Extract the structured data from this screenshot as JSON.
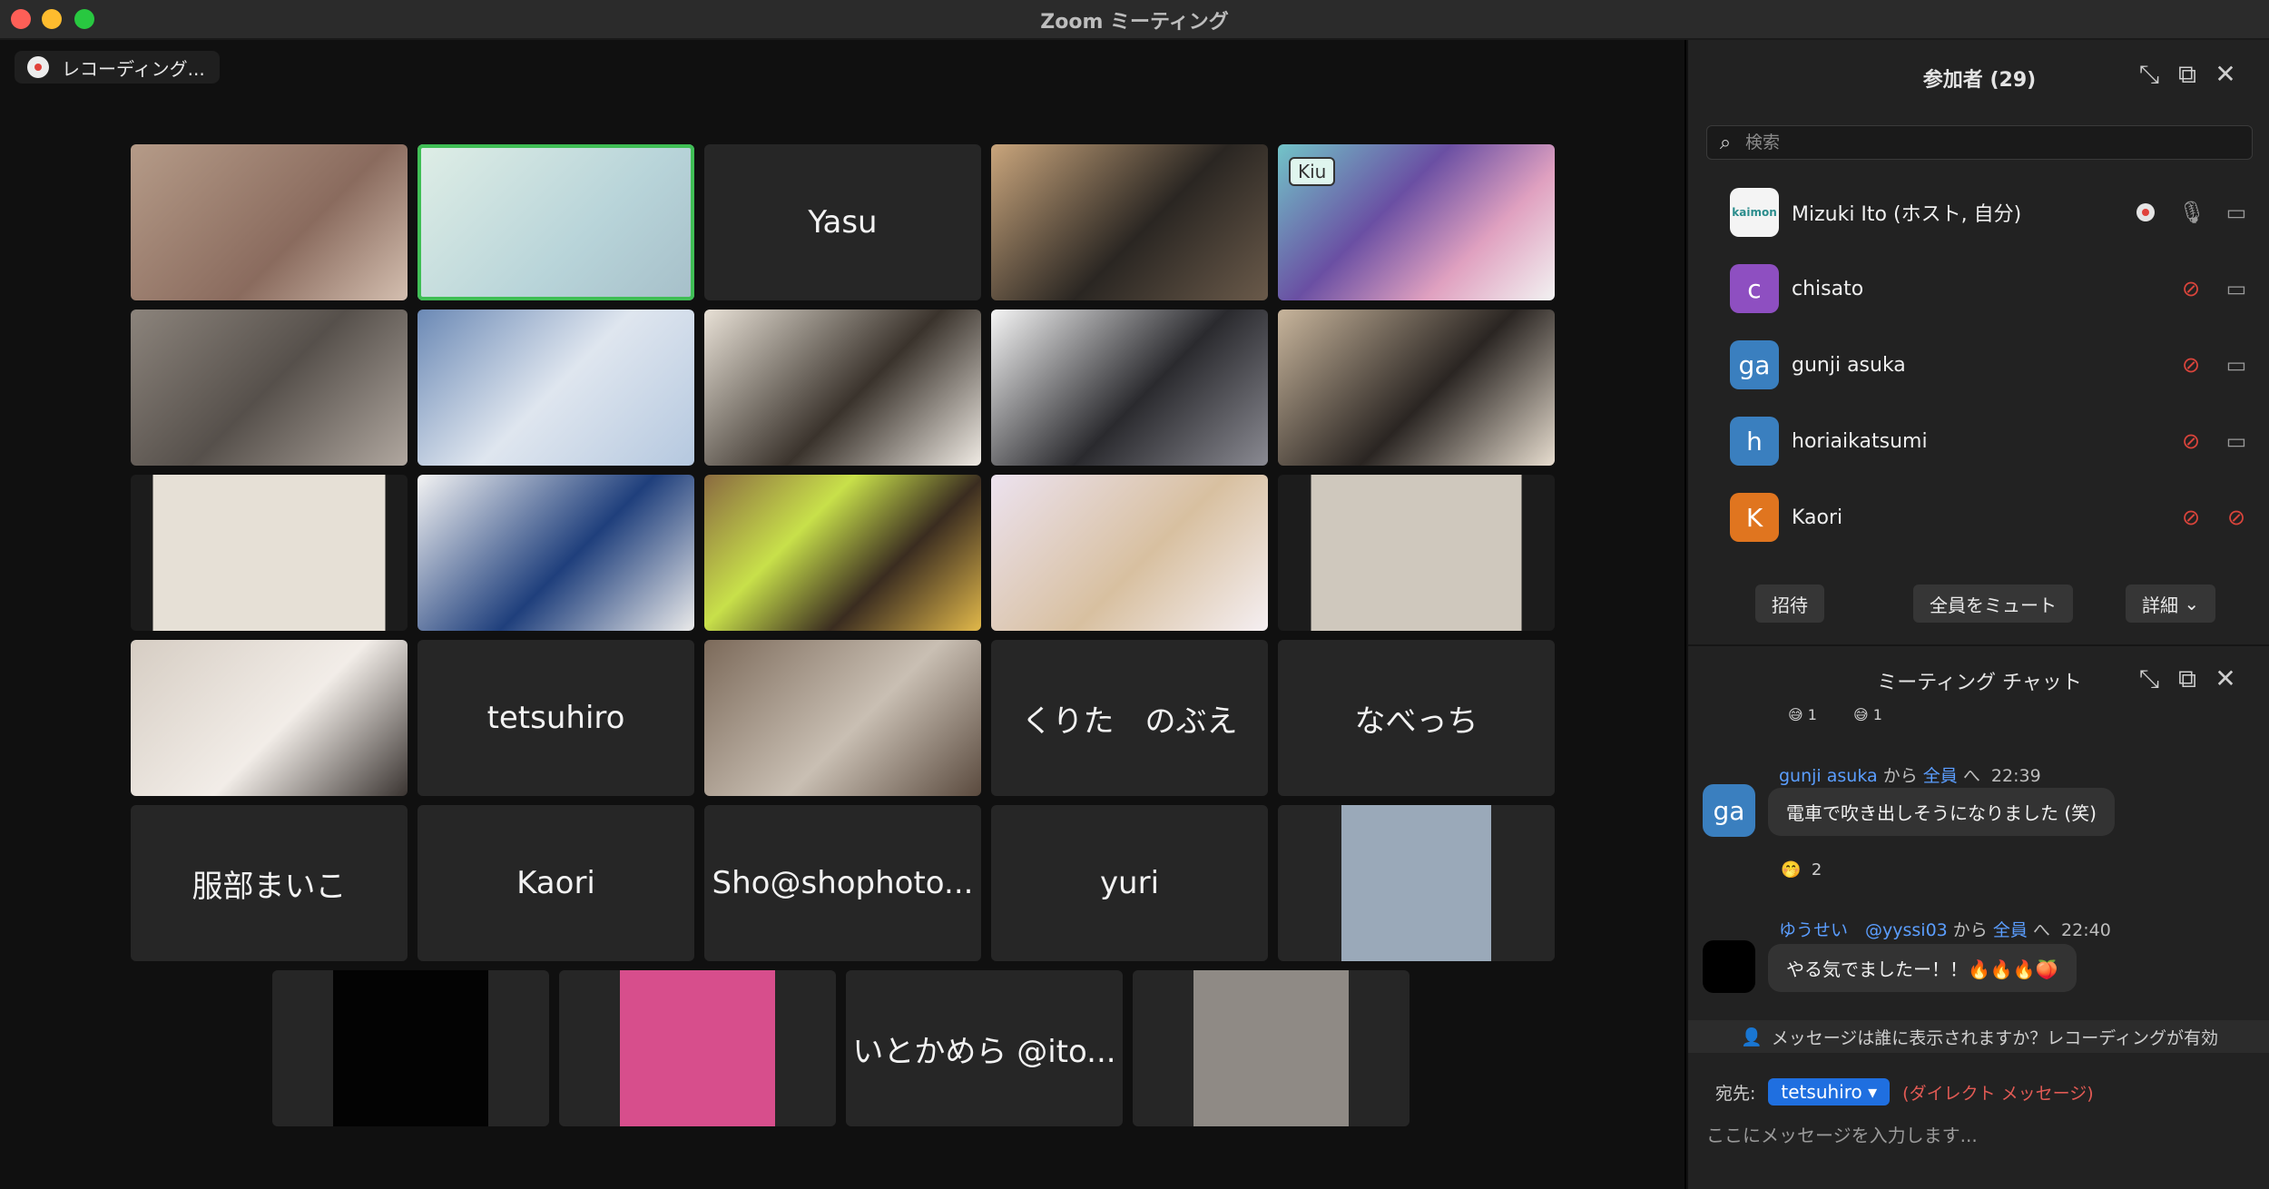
{
  "window": {
    "title": "Zoom ミーティング"
  },
  "recording": {
    "label": "レコーディング..."
  },
  "video_tiles": [
    {
      "type": "video",
      "label": ""
    },
    {
      "type": "video",
      "label": "",
      "active": true
    },
    {
      "type": "name",
      "label": "Yasu"
    },
    {
      "type": "video",
      "label": ""
    },
    {
      "type": "video",
      "label": "",
      "badge": "Kiu"
    },
    {
      "type": "video",
      "label": ""
    },
    {
      "type": "video",
      "label": ""
    },
    {
      "type": "video",
      "label": ""
    },
    {
      "type": "video",
      "label": ""
    },
    {
      "type": "video",
      "label": ""
    },
    {
      "type": "video",
      "label": ""
    },
    {
      "type": "video",
      "label": ""
    },
    {
      "type": "video",
      "label": ""
    },
    {
      "type": "video",
      "label": ""
    },
    {
      "type": "video",
      "label": ""
    },
    {
      "type": "video",
      "label": ""
    },
    {
      "type": "name",
      "label": "tetsuhiro"
    },
    {
      "type": "video",
      "label": ""
    },
    {
      "type": "name",
      "label": "くりた　のぶえ"
    },
    {
      "type": "name",
      "label": "なべっち"
    },
    {
      "type": "name",
      "label": "服部まいこ"
    },
    {
      "type": "name",
      "label": "Kaori"
    },
    {
      "type": "name",
      "label": "Sho@shophoto..."
    },
    {
      "type": "name",
      "label": "yuri"
    },
    {
      "type": "photo",
      "label": ""
    },
    {
      "type": "photo",
      "label": ""
    },
    {
      "type": "photo",
      "label": ""
    },
    {
      "type": "name",
      "label": "いとかめら @ito..."
    },
    {
      "type": "photo",
      "label": ""
    }
  ],
  "participants_panel": {
    "title": "参加者 (29)",
    "search_placeholder": "検索",
    "participants": [
      {
        "name": "Mizuki Ito (ホスト, 自分)",
        "avatar_text": "kaimon",
        "avatar_color": "#f4f4f4",
        "mic": "on",
        "video": "off",
        "recording": true
      },
      {
        "name": "chisato",
        "avatar_text": "c",
        "avatar_color": "#8e4fc1",
        "mic": "muted",
        "video": "off"
      },
      {
        "name": "gunji asuka",
        "avatar_text": "ga",
        "avatar_color": "#3a7fbf",
        "mic": "muted",
        "video": "off"
      },
      {
        "name": "horiaikatsumi",
        "avatar_text": "h",
        "avatar_color": "#3a7fbf",
        "mic": "muted",
        "video": "off"
      },
      {
        "name": "Kaori",
        "avatar_text": "K",
        "avatar_color": "#e0751f",
        "mic": "muted",
        "video": "disabled"
      }
    ],
    "buttons": {
      "invite": "招待",
      "mute_all": "全員をミュート",
      "more": "詳細"
    }
  },
  "chat": {
    "title": "ミーティング チャット",
    "top_reactions": [
      {
        "emoji": "😅",
        "count": "1"
      },
      {
        "emoji": "😅",
        "count": "1"
      }
    ],
    "messages": [
      {
        "sender": "gunji asuka",
        "from_label": "から",
        "to": "全員",
        "to_suffix": "へ",
        "time": "22:39",
        "avatar_text": "ga",
        "avatar_color": "#3a7fbf",
        "text": "電車で吹き出しそうになりました (笑)",
        "reaction": {
          "emoji": "🤭",
          "count": "2"
        }
      },
      {
        "sender": "ゆうせい　@yyssi03",
        "from_label": "から",
        "to": "全員",
        "to_suffix": "へ",
        "time": "22:40",
        "avatar_text": "",
        "avatar_color": "#000000",
        "text": "やる気でましたー！！🔥🔥🔥🍑"
      }
    ],
    "visibility_note": "メッセージは誰に表示されますか？レコーディングが有効",
    "compose": {
      "to_label": "宛先:",
      "recipient": "tetsuhiro",
      "dm_note": "(ダイレクト メッセージ)",
      "placeholder": "ここにメッセージを入力します..."
    }
  },
  "colors": {
    "active_speaker": "#3fbe55",
    "link_blue": "#5b9eff",
    "muted_red": "#d9443b",
    "chip_blue": "#1f6fe0"
  }
}
